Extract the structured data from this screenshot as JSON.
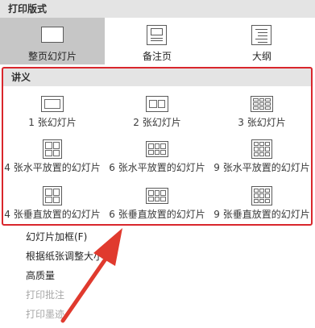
{
  "print_layout": {
    "title": "打印版式",
    "options": [
      {
        "label": "整页幻灯片",
        "selected": true
      },
      {
        "label": "备注页",
        "selected": false
      },
      {
        "label": "大纲",
        "selected": false
      }
    ]
  },
  "handouts": {
    "title": "讲义",
    "items": [
      {
        "label": "1 张幻灯片"
      },
      {
        "label": "2 张幻灯片"
      },
      {
        "label": "3 张幻灯片"
      },
      {
        "label": "4 张水平放置的幻灯片"
      },
      {
        "label": "6 张水平放置的幻灯片"
      },
      {
        "label": "9 张水平放置的幻灯片"
      },
      {
        "label": "4 张垂直放置的幻灯片"
      },
      {
        "label": "6 张垂直放置的幻灯片"
      },
      {
        "label": "9 张垂直放置的幻灯片"
      }
    ]
  },
  "options": [
    {
      "label": "幻灯片加框(F)",
      "enabled": true
    },
    {
      "label": "根据纸张调整大小(S)",
      "enabled": true
    },
    {
      "label": "高质量",
      "enabled": true
    },
    {
      "label": "打印批注",
      "enabled": false
    },
    {
      "label": "打印墨迹",
      "enabled": false
    }
  ],
  "colors": {
    "highlight_frame": "#d9262c",
    "arrow": "#e03a2e",
    "selected_bg": "#c6c6c6",
    "header_bg": "#e4e4e4"
  }
}
